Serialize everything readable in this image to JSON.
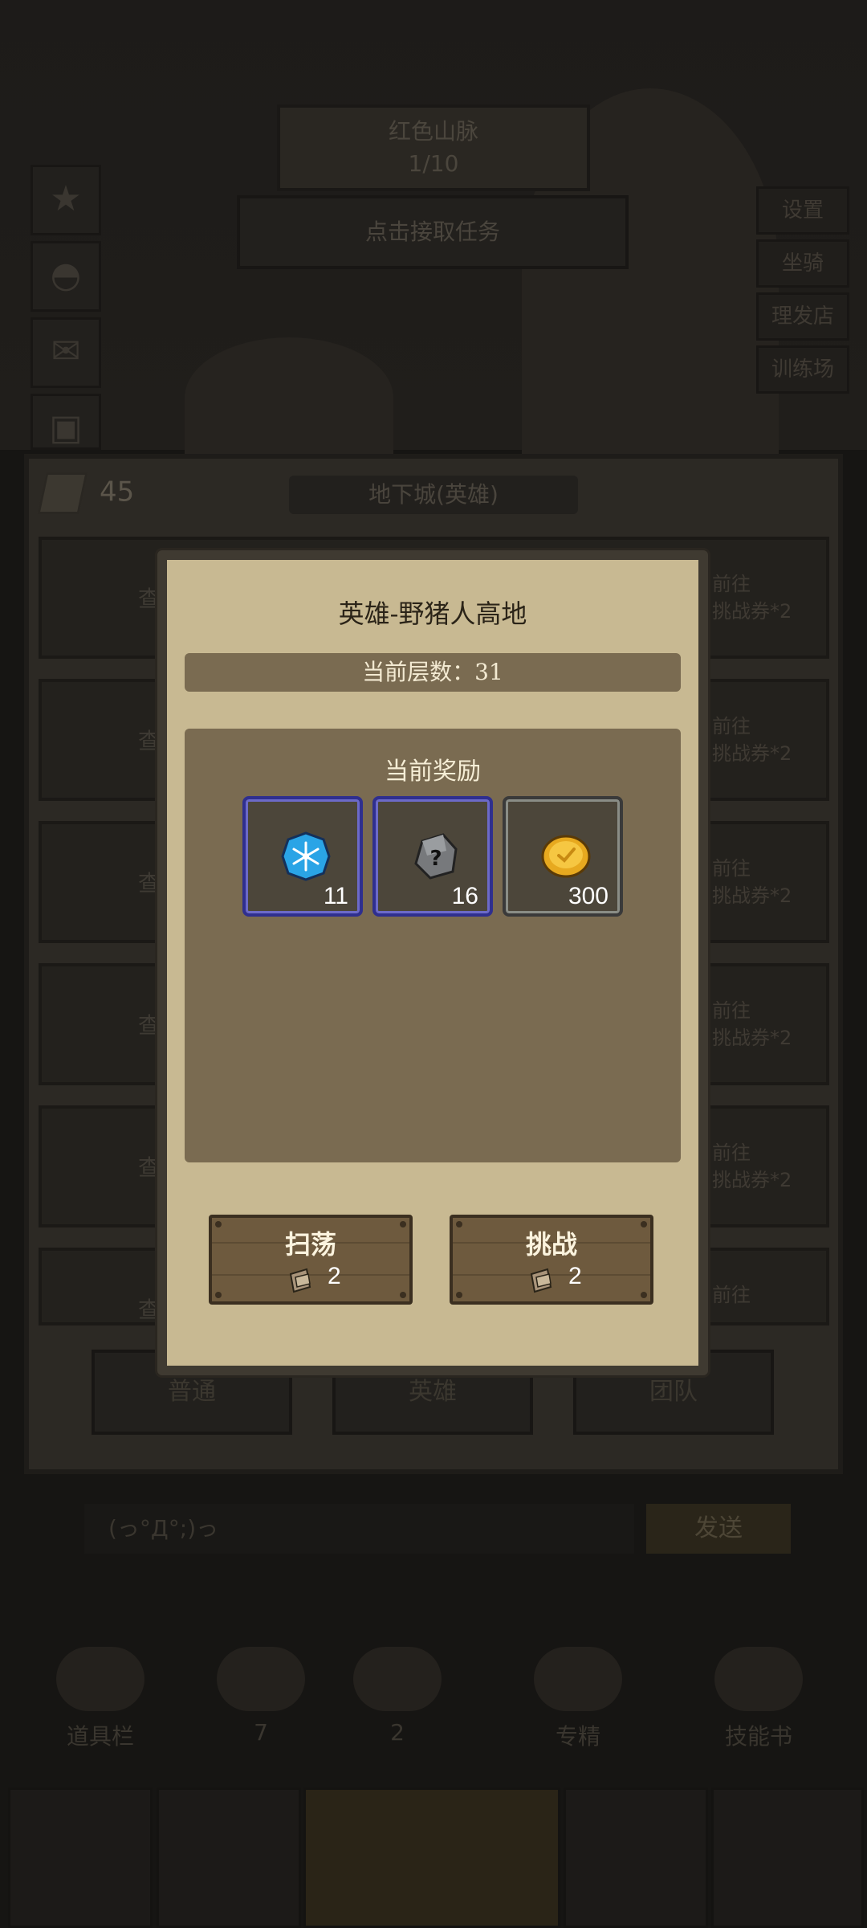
{
  "background": {
    "region_banner": {
      "name": "红色山脉",
      "progress": "1/10"
    },
    "task_bar": "点击接取任务",
    "right_menu": [
      "设置",
      "坐骑",
      "理发店",
      "训练场"
    ],
    "dungeon_panel": {
      "ticket_count": "45",
      "title": "地下城(英雄)",
      "row_left_label": "查",
      "row_right_label_1": "前往",
      "row_right_label_2": "挑战券*2",
      "tabs": [
        "普通",
        "英雄",
        "团队"
      ]
    },
    "chat": {
      "input_placeholder": "(っ°Д°;)っ",
      "send_label": "发送"
    },
    "shop": {
      "items": [
        {
          "label": "道具栏"
        },
        {
          "label": "7"
        },
        {
          "label": "2"
        },
        {
          "label": "专精"
        },
        {
          "label": "技能书"
        }
      ]
    }
  },
  "modal": {
    "title": "英雄-野猪人高地",
    "floor_label": "当前层数：31",
    "reward_title": "当前奖励",
    "rewards": [
      {
        "icon": "snowflake-gem-icon",
        "count": "11",
        "rarity": "blue"
      },
      {
        "icon": "mystery-ore-icon",
        "count": "16",
        "rarity": "blue"
      },
      {
        "icon": "gold-coin-icon",
        "count": "300",
        "rarity": "gray"
      }
    ],
    "buttons": {
      "sweep": {
        "label": "扫荡",
        "cost": "2"
      },
      "challenge": {
        "label": "挑战",
        "cost": "2"
      }
    }
  }
}
